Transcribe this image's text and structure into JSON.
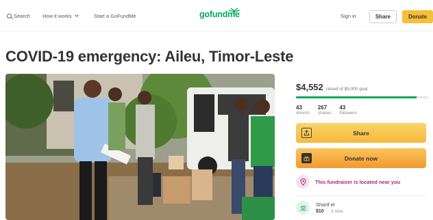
{
  "nav": {
    "search_label": "Search",
    "how_label": "How it works",
    "start_label": "Start a GoFundMe",
    "logo_text": "gofundme",
    "signin_label": "Sign in",
    "share_label": "Share",
    "donate_label": "Donate"
  },
  "page": {
    "title": "COVID-19 emergency: Aileu, Timor-Leste"
  },
  "campaign": {
    "raised_amount": "$4,552",
    "goal_text": "raised of $5,000 goal",
    "progress_fraction": 0.91,
    "stats": [
      {
        "number": "43",
        "label": "donors"
      },
      {
        "number": "267",
        "label": "shares"
      },
      {
        "number": "43",
        "label": "followers"
      }
    ],
    "share_label": "Share",
    "donate_label": "Donate now",
    "near_text": "This fundraiser is located near you",
    "donor": {
      "name": "Sharif el",
      "amount": "$10",
      "time": "3 mos"
    }
  },
  "colors": {
    "brand_green": "#02a95c",
    "button_yellow": "#f6bf3a",
    "near_magenta": "#b0267a"
  },
  "icons": [
    "search-icon",
    "chevron-down-icon",
    "share-icon",
    "gift-icon",
    "location-icon",
    "heart-hand-icon"
  ]
}
